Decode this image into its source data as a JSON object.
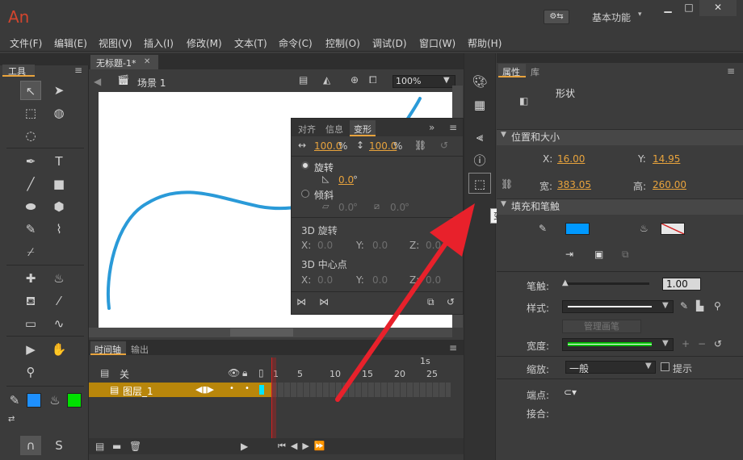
{
  "app": {
    "logo": "An",
    "workspace_label": "基本功能",
    "workspace_caret": "▾",
    "workspace_icon": "⚙⇆",
    "win_min": "▁",
    "win_max": "□",
    "win_close": "✕"
  },
  "menu": [
    "文件(F)",
    "编辑(E)",
    "视图(V)",
    "插入(I)",
    "修改(M)",
    "文本(T)",
    "命令(C)",
    "控制(O)",
    "调试(D)",
    "窗口(W)",
    "帮助(H)"
  ],
  "tools_panel": {
    "title": "工具"
  },
  "document": {
    "tab_title": "无标题-1*",
    "tab_close": "✕",
    "scene_label": "场景 1",
    "zoom": "100%"
  },
  "transform_panel": {
    "tabs": [
      "对齐",
      "信息",
      "变形"
    ],
    "width_pct": "100.0",
    "height_pct": "100.0",
    "pct_unit": "%",
    "rotate_label": "旋转",
    "rotate_value": "0.0",
    "degree": "°",
    "skew_label": "倾斜",
    "skew_h": "0.0",
    "skew_v": "0.0",
    "rot3d_label": "3D 旋转",
    "center3d_label": "3D 中心点",
    "x_label": "X:",
    "y_label": "Y:",
    "z_label": "Z:",
    "rot3d_x": "0.0",
    "rot3d_y": "0.0",
    "rot3d_z": "0.0",
    "c3d_x": "0.0",
    "c3d_y": "0.0",
    "c3d_z": "0.0"
  },
  "timeline": {
    "tabs": [
      "时间轴",
      "输出"
    ],
    "layer_off_label": "关",
    "layer_name": "图层_1",
    "second_label": "1s",
    "frame_ticks": [
      "1",
      "5",
      "10",
      "15",
      "20",
      "25"
    ]
  },
  "dock_tooltip": "变形",
  "properties": {
    "tabs": [
      "属性",
      "库"
    ],
    "object_type": "形状",
    "pos_size_header": "位置和大小",
    "x_label": "X:",
    "x_value": "16.00",
    "y_label": "Y:",
    "y_value": "14.95",
    "w_label": "宽:",
    "w_value": "383.05",
    "h_label": "高:",
    "h_value": "260.00",
    "fill_stroke_header": "填充和笔触",
    "stroke_label": "笔触:",
    "stroke_value": "1.00",
    "style_label": "样式:",
    "manage_brush": "管理画笔",
    "width_label": "宽度:",
    "scale_label": "缩放:",
    "scale_value": "一般",
    "hint_label": "提示",
    "cap_label": "端点:",
    "join_label": "接合:"
  },
  "colors": {
    "stroke": "#0099ff",
    "tool_stroke": "#1e90ff",
    "tool_fill": "#00e000",
    "curve": "#2a9ad8",
    "arrow": "#e8212b",
    "accent_value": "#e8a33c"
  }
}
